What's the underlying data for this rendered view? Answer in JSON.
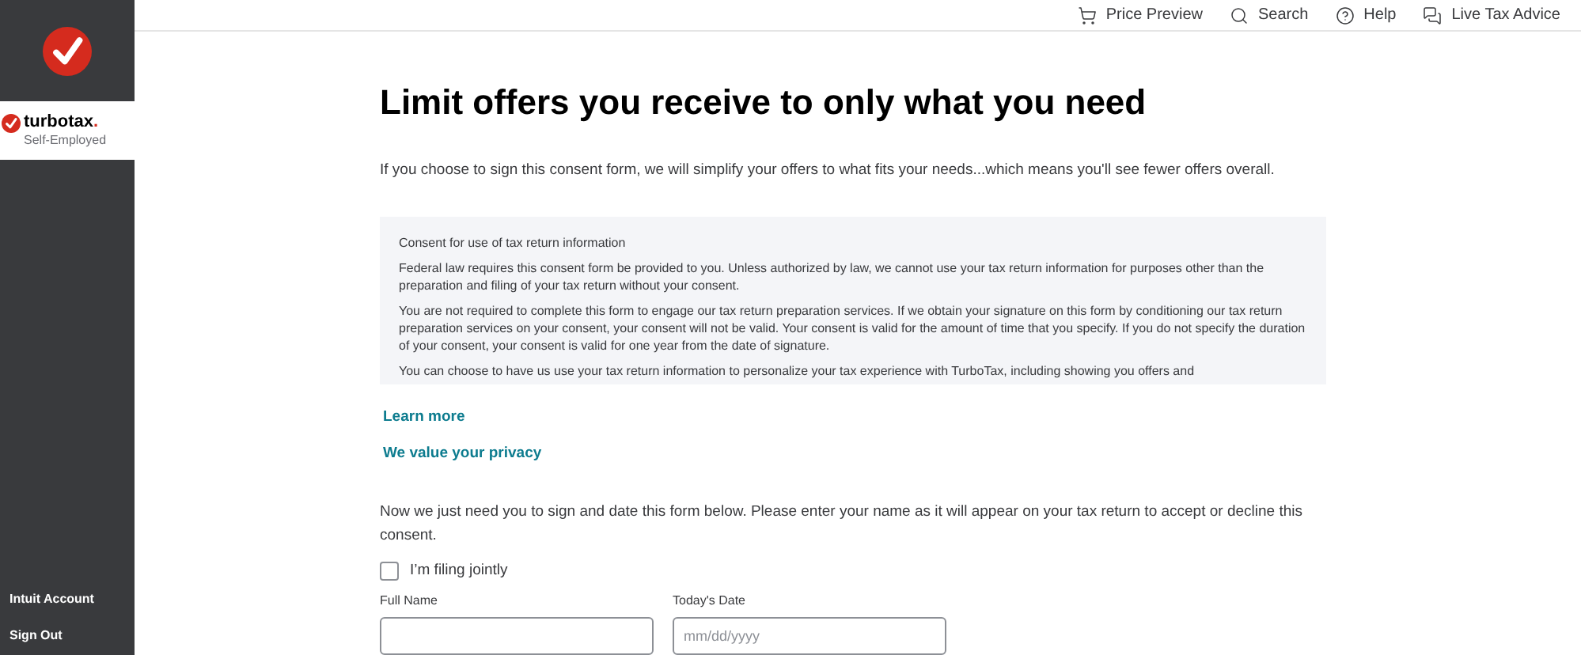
{
  "sidebar": {
    "brand": {
      "name": "turbotax",
      "dot": ".",
      "edition": "Self-Employed"
    },
    "items": [
      {
        "label": "Intuit Account"
      },
      {
        "label": "Sign Out"
      }
    ]
  },
  "top_nav": [
    {
      "kind": "cart",
      "label": "Price Preview"
    },
    {
      "kind": "search",
      "label": "Search"
    },
    {
      "kind": "help",
      "label": "Help"
    },
    {
      "kind": "advice",
      "label": "Live Tax Advice"
    }
  ],
  "title": "Limit offers you receive to only what you need",
  "intro": "If you choose to sign this consent form, we will simplify your offers to what fits your needs...which means you'll see fewer offers overall.",
  "consent_box": {
    "heading": "Consent for use of tax return information",
    "paragraphs": [
      "Federal law requires this consent form be provided to you. Unless authorized by law, we cannot use your tax return information for purposes other than the preparation and filing of your tax return without your consent.",
      "You are not required to complete this form to engage our tax return preparation services. If we obtain your signature on this form by conditioning our tax return preparation services on your consent, your consent will not be valid. Your consent is valid for the amount of time that you specify. If you do not specify the duration of your consent, your consent is valid for one year from the date of signature.",
      "You can choose to have us use your tax return information to personalize your tax experience with TurboTax, including showing you offers and"
    ]
  },
  "links": [
    "Learn more",
    "We value your privacy"
  ],
  "instructions": "Now we just need you to sign and date this form below. Please enter your name as it will appear on your tax return to accept or decline this consent.",
  "filing_jointly": {
    "label": "I’m filing jointly",
    "checked": false
  },
  "fields": [
    {
      "label": "Full Name"
    },
    {
      "label": "Today's Date",
      "placeholder": "mm/dd/yyyy"
    }
  ]
}
